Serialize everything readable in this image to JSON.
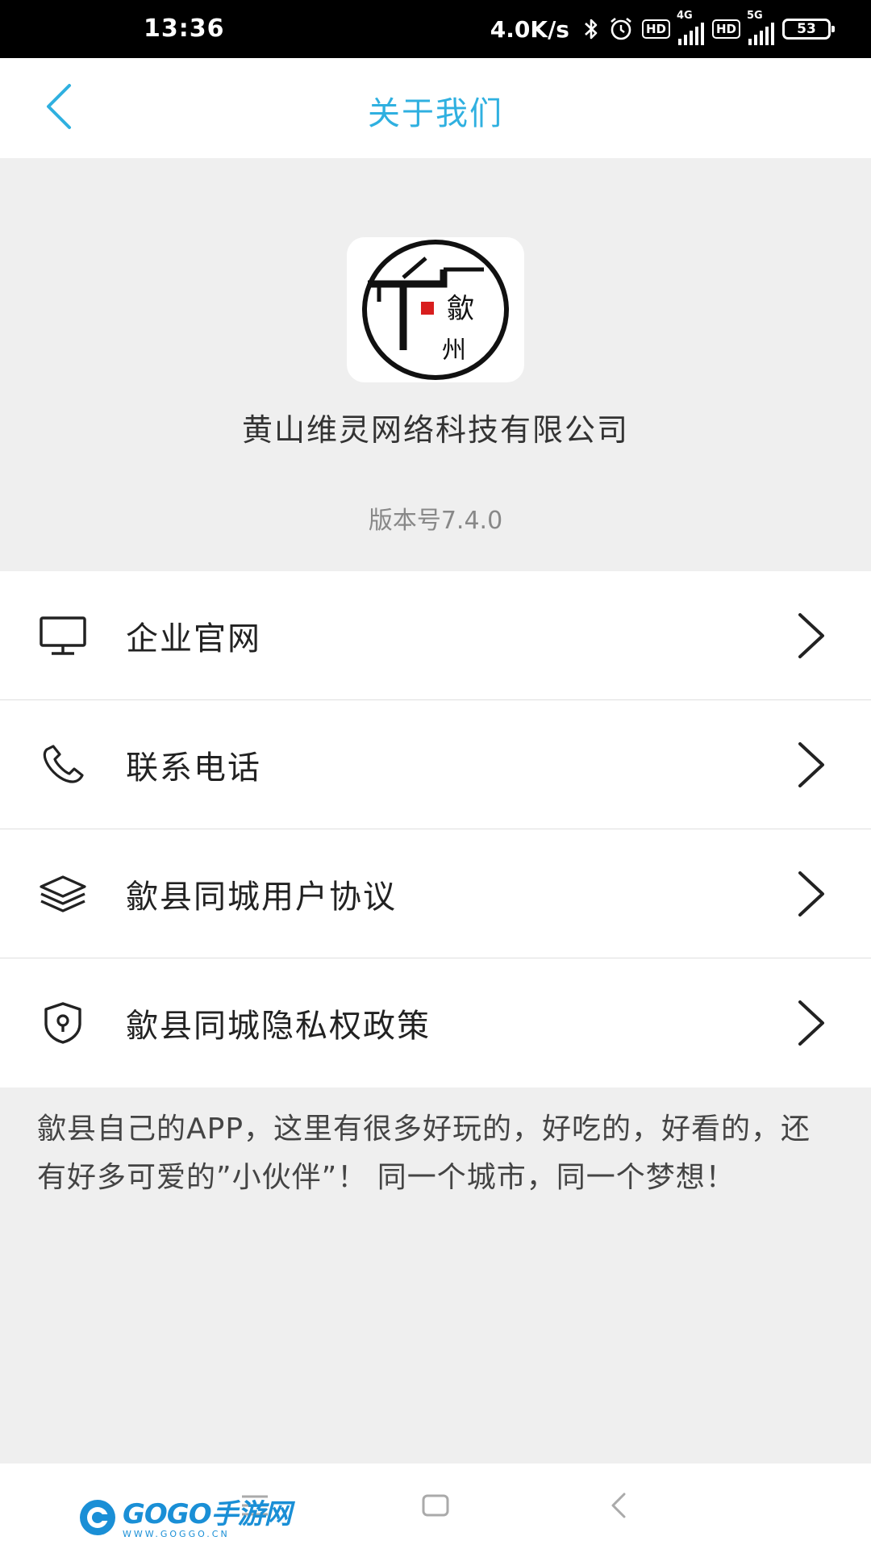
{
  "status_bar": {
    "time": "13:36",
    "net_speed": "4.0K/s",
    "hd1": "HD",
    "net1": "4G",
    "hd2": "HD",
    "net2": "5G",
    "battery": "53"
  },
  "header": {
    "title": "关于我们",
    "back_icon": "chevron-left-icon",
    "accent_color": "#2fb0e0"
  },
  "about": {
    "logo_icon": "shexian-logo-icon",
    "logo_glyph_top": "歙",
    "logo_glyph_bottom": "州",
    "company": "黄山维灵网络科技有限公司",
    "version": "版本号7.4.0"
  },
  "menu": {
    "items": [
      {
        "label": "企业官网",
        "icon": "monitor-icon"
      },
      {
        "label": "联系电话",
        "icon": "phone-icon"
      },
      {
        "label": "歙县同城用户协议",
        "icon": "layers-icon"
      },
      {
        "label": "歙县同城隐私权政策",
        "icon": "shield-lock-icon"
      }
    ],
    "chevron_icon": "chevron-right-icon"
  },
  "description": "歙县自己的APP，这里有很多好玩的，好吃的，好看的，还有好多可爱的”小伙伴”！ 同一个城市，同一个梦想！",
  "nav_bar": {
    "menu_icon": "menu-icon",
    "home_icon": "home-square-icon",
    "back_icon": "back-triangle-icon"
  },
  "watermark": {
    "brand": "GOGO手游网",
    "url": "WWW.GOGGO.CN"
  }
}
